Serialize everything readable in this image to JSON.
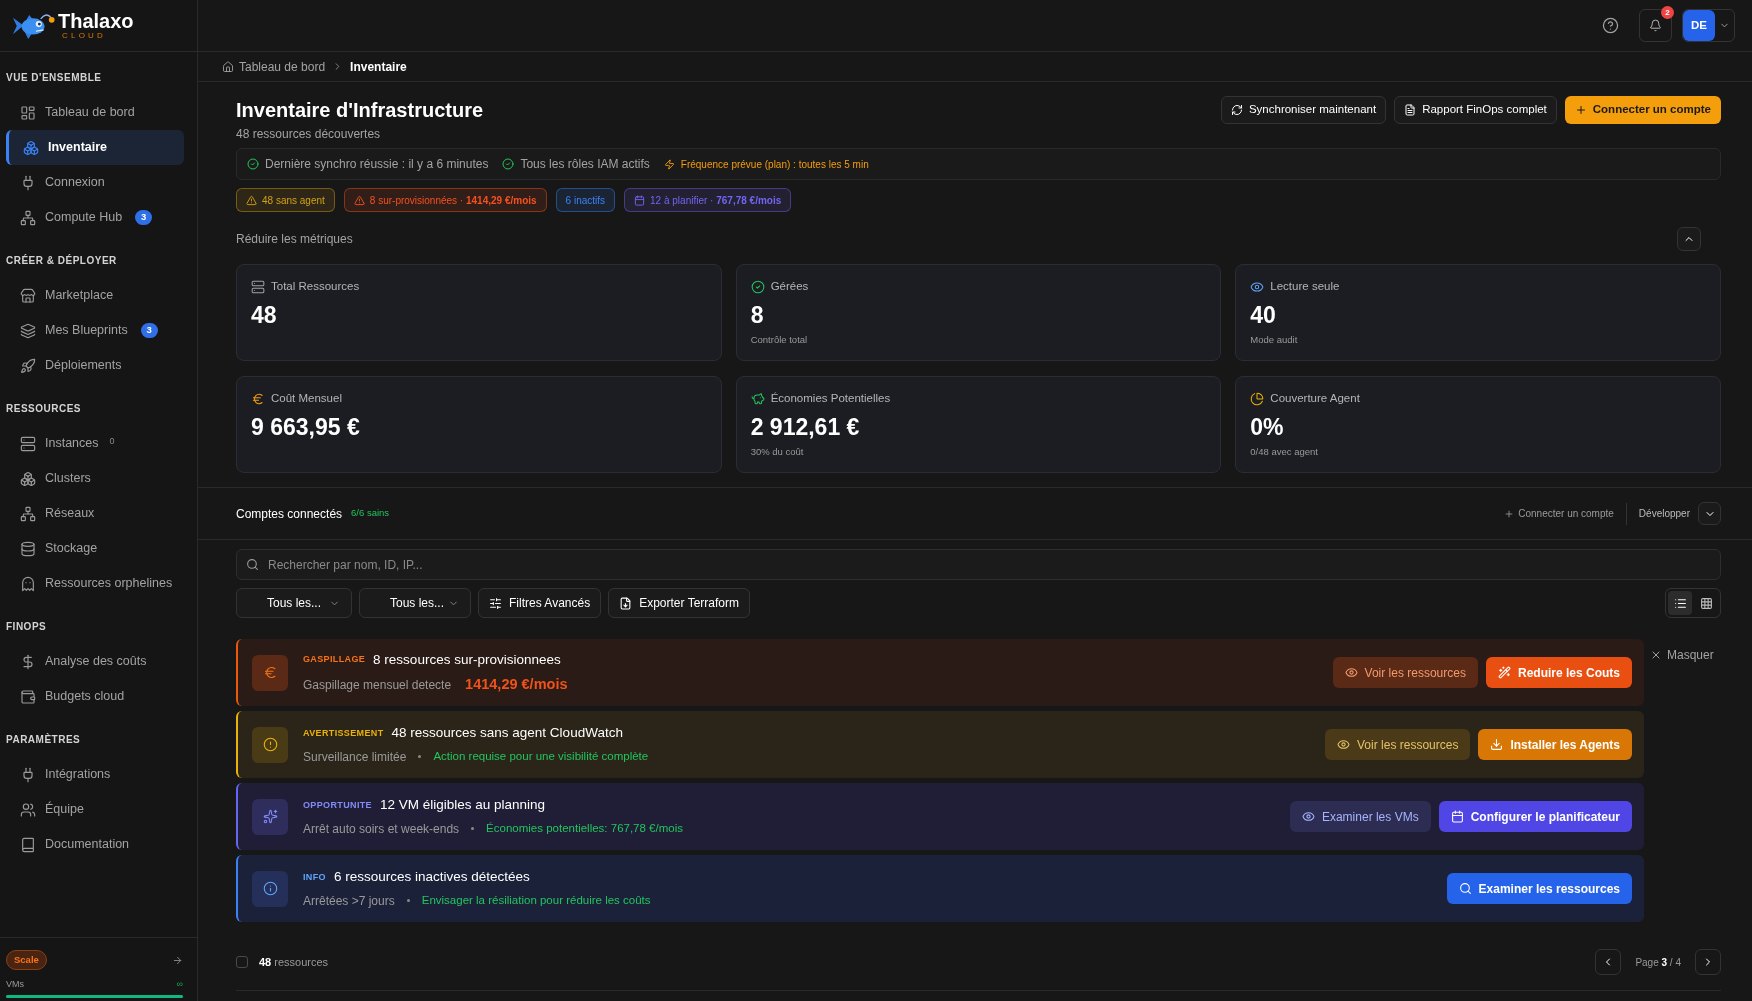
{
  "brand": {
    "name": "Thalaxo",
    "tagline": "CLOUD"
  },
  "sidebar": {
    "sections": [
      {
        "title": "VUE D'ENSEMBLE",
        "items": [
          {
            "label": "Tableau de bord",
            "selected": false
          },
          {
            "label": "Inventaire",
            "selected": true
          },
          {
            "label": "Connexion",
            "selected": false
          },
          {
            "label": "Compute Hub",
            "selected": false,
            "badge": "3"
          }
        ]
      },
      {
        "title": "CRÉER & DÉPLOYER",
        "items": [
          {
            "label": "Marketplace",
            "selected": false
          },
          {
            "label": "Mes Blueprints",
            "selected": false,
            "badge": "3"
          },
          {
            "label": "Déploiements",
            "selected": false
          }
        ]
      },
      {
        "title": "RESSOURCES",
        "items": [
          {
            "label": "Instances",
            "selected": false,
            "count": "0"
          },
          {
            "label": "Clusters",
            "selected": false
          },
          {
            "label": "Réseaux",
            "selected": false
          },
          {
            "label": "Stockage",
            "selected": false
          },
          {
            "label": "Ressources orphelines",
            "selected": false
          }
        ]
      },
      {
        "title": "FINOPS",
        "items": [
          {
            "label": "Analyse des coûts",
            "selected": false
          },
          {
            "label": "Budgets cloud",
            "selected": false
          }
        ]
      },
      {
        "title": "PARAMÈTRES",
        "items": [
          {
            "label": "Intégrations",
            "selected": false
          },
          {
            "label": "Équipe",
            "selected": false
          },
          {
            "label": "Documentation",
            "selected": false
          }
        ]
      }
    ],
    "footer": {
      "plan": "Scale",
      "usage": {
        "label": "VMs",
        "reading": "∞",
        "level": 1
      }
    }
  },
  "header": {
    "notifications": "2",
    "avatar": "DE"
  },
  "breadcrumb": [
    "Tableau de bord",
    "Inventaire"
  ],
  "page": {
    "title": "Inventaire d'Infrastructure",
    "subtitle": "48 ressources découvertes",
    "actions": [
      {
        "label": "Synchroniser maintenant",
        "kind": "sync"
      },
      {
        "label": "Rapport FinOps complet",
        "kind": "report"
      },
      {
        "label": "Connecter un compte",
        "kind": "primary"
      }
    ]
  },
  "sync_status": [
    {
      "text": "Dernière synchro réussie : il y a 6 minutes",
      "kind": "ok"
    },
    {
      "text": "Tous les rôles IAM actifs",
      "kind": "ok"
    },
    {
      "text": "Fréquence prévue (plan) : toutes les 5 min",
      "kind": "schedule"
    }
  ],
  "tags": [
    {
      "text": "48 sans agent",
      "kind": "warning",
      "color": "#d4a017"
    },
    {
      "text": "8 sur-provisionnées · **1414,29 €/mois**",
      "kind": "warning",
      "color": "#f4511e"
    },
    {
      "text": "6 inactifs",
      "kind": "plain",
      "color": "#3b82f6"
    },
    {
      "text": "12 à planifier · **767,78 €/mois**",
      "kind": "schedule",
      "color": "#7265f2"
    }
  ],
  "metrics_toggle": {
    "label": "Réduire les métriques",
    "expanded": true
  },
  "metrics": [
    {
      "label": "Total Ressources",
      "value": "48"
    },
    {
      "label": "Gérées",
      "value": "8",
      "note": "Contrôle total"
    },
    {
      "label": "Lecture seule",
      "value": "40",
      "note": "Mode audit"
    },
    {
      "label": "Coût Mensuel",
      "value": "9 663,95 €"
    },
    {
      "label": "Économies Potentielles",
      "value": "2 912,61 €",
      "note": "30% du coût"
    },
    {
      "label": "Couverture Agent",
      "value": "0%",
      "note": "0/48 avec agent"
    }
  ],
  "accounts": {
    "title": "Comptes connectés",
    "health": "6/6 sains",
    "connect": "Connecter un compte",
    "expand": "Développer",
    "expanded": false
  },
  "search": {
    "placeholder": "Rechercher par nom, ID, IP..."
  },
  "filters": {
    "selects": [
      "Tous les...",
      "Tous les..."
    ],
    "buttons": [
      {
        "label": "Filtres Avancés",
        "kind": "filters"
      },
      {
        "label": "Exporter Terraform",
        "kind": "export"
      }
    ],
    "views": [
      {
        "kind": "list",
        "selected": true
      },
      {
        "kind": "grid",
        "selected": false
      }
    ]
  },
  "alerts": {
    "dismiss": "Masquer",
    "items": [
      {
        "kind": "waste",
        "label": "GASPILLAGE",
        "title": "8 ressources sur-provisionnees",
        "detail": "Gaspillage mensuel detecte",
        "amount": "1414,29 €/mois",
        "actions": [
          {
            "label": "Voir les ressources",
            "kind": "secondary"
          },
          {
            "label": "Reduire les Couts",
            "kind": "primary"
          }
        ]
      },
      {
        "kind": "warning",
        "label": "AVERTISSEMENT",
        "title": "48 ressources sans agent CloudWatch",
        "detail": "Surveillance limitée",
        "note": "Action requise pour une visibilité complète",
        "actions": [
          {
            "label": "Voir les ressources",
            "kind": "secondary"
          },
          {
            "label": "Installer les Agents",
            "kind": "primary"
          }
        ]
      },
      {
        "kind": "opportunity",
        "label": "OPPORTUNITE",
        "title": "12 VM éligibles au planning",
        "detail": "Arrêt auto soirs et week-ends",
        "note": "Économies potentielles: 767,78 €/mois",
        "actions": [
          {
            "label": "Examiner les VMs",
            "kind": "secondary"
          },
          {
            "label": "Configurer le planificateur",
            "kind": "primary"
          }
        ]
      },
      {
        "kind": "info",
        "label": "INFO",
        "title": "6 ressources inactives détectées",
        "detail": "Arrêtées >7 jours",
        "note": "Envisager la résiliation pour réduire les coûts",
        "actions": [
          {
            "label": "Examiner les ressources",
            "kind": "primary"
          }
        ]
      }
    ]
  },
  "footer": {
    "select_all": {
      "checked": false
    },
    "count": "**48** ressources",
    "page": "Page **3** / 4"
  }
}
